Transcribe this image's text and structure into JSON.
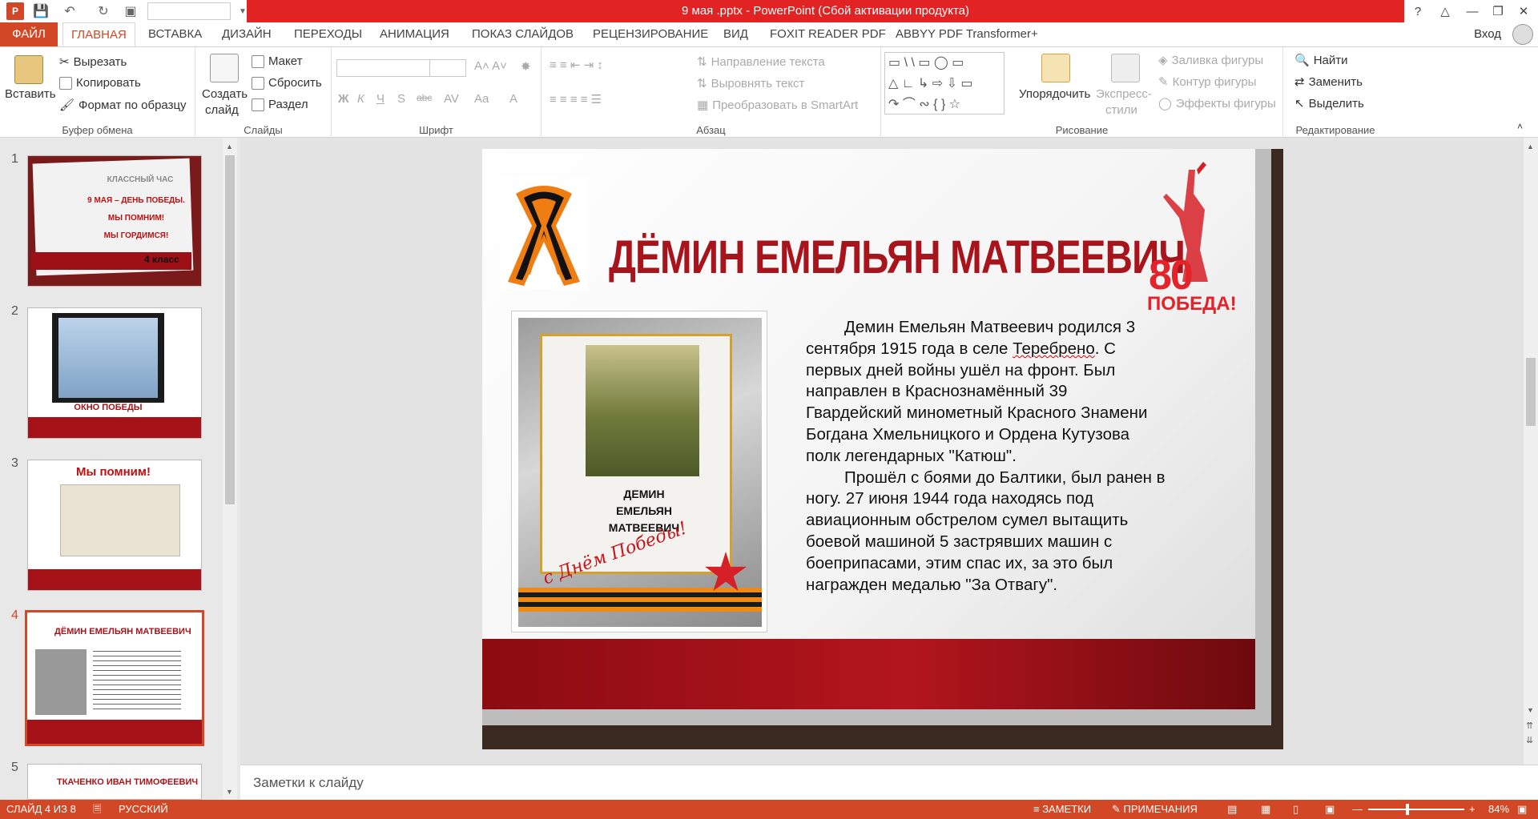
{
  "window": {
    "title": "9 мая .pptx -  PowerPoint (Сбой активации продукта)",
    "app_logo": "P",
    "accent": "#d24726",
    "title_bar_color": "#e12323"
  },
  "tabs": {
    "file": "ФАЙЛ",
    "items": [
      "ГЛАВНАЯ",
      "ВСТАВКА",
      "ДИЗАЙН",
      "ПЕРЕХОДЫ",
      "АНИМАЦИЯ",
      "ПОКАЗ СЛАЙДОВ",
      "РЕЦЕНЗИРОВАНИЕ",
      "ВИД",
      "FOXIT READER PDF",
      "ABBYY PDF Transformer+"
    ],
    "active": "ГЛАВНАЯ",
    "login": "Вход"
  },
  "ribbon": {
    "clipboard": {
      "label": "Буфер обмена",
      "paste": "Вставить",
      "cut": "Вырезать",
      "copy": "Копировать",
      "format_painter": "Формат по образцу"
    },
    "slides": {
      "label": "Слайды",
      "new_slide_line1": "Создать",
      "new_slide_line2": "слайд",
      "layout": "Макет",
      "reset": "Сбросить",
      "section": "Раздел"
    },
    "font": {
      "label": "Шрифт"
    },
    "paragraph": {
      "label": "Абзац",
      "text_direction": "Направление текста",
      "align_text": "Выровнять текст",
      "smartart": "Преобразовать в SmartArt"
    },
    "drawing": {
      "label": "Рисование",
      "arrange": "Упорядочить",
      "quick_styles_line1": "Экспресс-",
      "quick_styles_line2": "стили",
      "shape_fill": "Заливка фигуры",
      "shape_outline": "Контур фигуры",
      "shape_effects": "Эффекты фигуры"
    },
    "editing": {
      "label": "Редактирование",
      "find": "Найти",
      "replace": "Заменить",
      "select": "Выделить"
    }
  },
  "thumbnails": [
    {
      "num": "1",
      "lines": [
        "КЛАССНЫЙ ЧАС",
        "9 МАЯ – ДЕНЬ ПОБЕДЫ.",
        "МЫ ПОМНИМ!",
        "МЫ ГОРДИМСЯ!"
      ],
      "footer": "4 класс"
    },
    {
      "num": "2",
      "caption": "ОКНО ПОБЕДЫ"
    },
    {
      "num": "3",
      "caption": "Мы помним!"
    },
    {
      "num": "4",
      "caption": "ДЁМИН ЕМЕЛЬЯН МАТВЕЕВИЧ"
    },
    {
      "num": "5",
      "caption": "ТКАЧЕНКО ИВАН ТИМОФЕЕВИЧ"
    }
  ],
  "slide": {
    "title": "ДЁМИН ЕМЕЛЬЯН МАТВЕЕВИЧ",
    "emblem_number": "80",
    "emblem_text": "ПОБЕДА!",
    "portrait_name": [
      "ДЕМИН",
      "ЕМЕЛЬЯН",
      "МАТВЕЕВИЧ"
    ],
    "portrait_script": "с Днём Победы!",
    "bio_p1_before": "Демин Емельян Матвеевич родился 3 сентября 1915 года в селе ",
    "bio_p1_village": "Теребрено",
    "bio_p1_after": ". С первых дней войны ушёл на фронт. Был направлен в Краснознамённый 39 Гвардейский минометный Красного Знамени Богдана Хмельницкого и Ордена Кутузова полк легендарных \"Катюш\".",
    "bio_p2": "Прошёл с боями до Балтики, был ранен в ногу. 27 июня 1944 года находясь под авиационным обстрелом сумел вытащить боевой машиной 5 застрявших машин с боеприпасами, этим спас их, за это был награжден медалью \"За Отвагу\"."
  },
  "notes": {
    "placeholder": "Заметки к слайду"
  },
  "status": {
    "slide_info": "СЛАЙД 4 ИЗ 8",
    "language": "РУССКИЙ",
    "notes": "ЗАМЕТКИ",
    "comments": "ПРИМЕЧАНИЯ",
    "zoom": "84%"
  }
}
